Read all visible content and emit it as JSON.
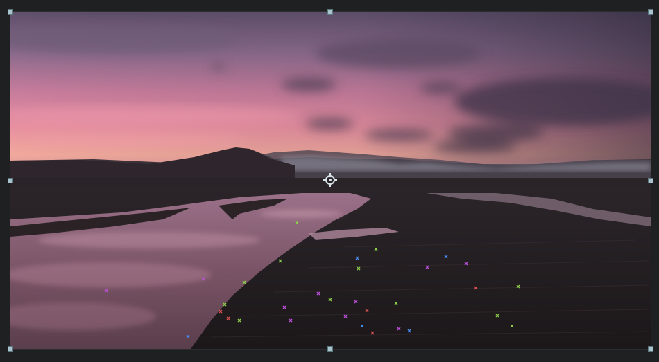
{
  "viewer": {
    "crosshair_icon": "crosshair-target-icon",
    "handle_color": "#a9c4cc",
    "tracker_colors": [
      "#e35b9a",
      "#8ecf4a",
      "#4a8df0",
      "#c050e0",
      "#d85050"
    ]
  }
}
